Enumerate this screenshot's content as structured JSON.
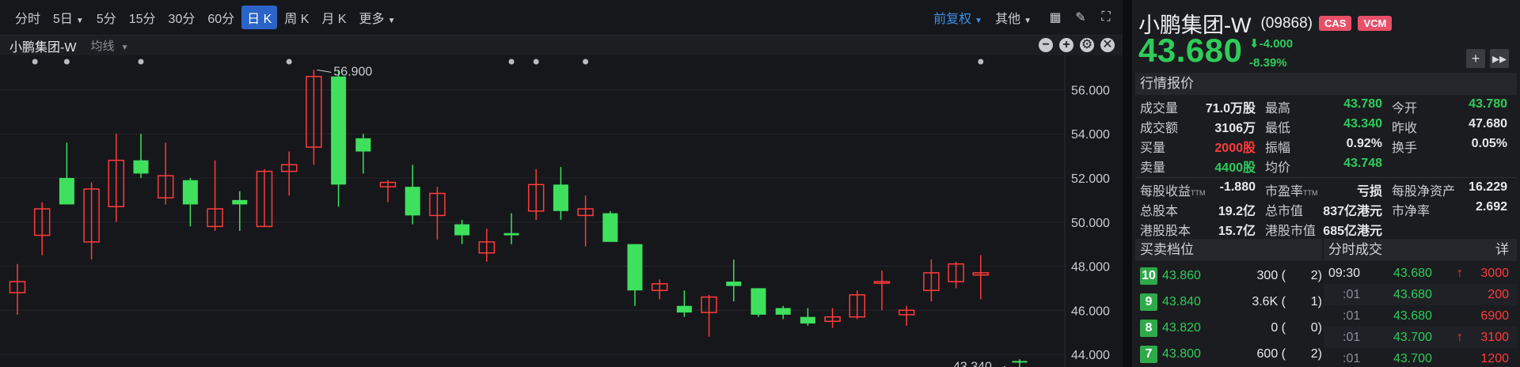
{
  "toolbar": {
    "periods": [
      {
        "label": "分时",
        "caret": false,
        "active": false
      },
      {
        "label": "5日",
        "caret": true,
        "active": false
      },
      {
        "label": "5分",
        "caret": false,
        "active": false
      },
      {
        "label": "15分",
        "caret": false,
        "active": false
      },
      {
        "label": "30分",
        "caret": false,
        "active": false
      },
      {
        "label": "60分",
        "caret": false,
        "active": false
      },
      {
        "label": "日 K",
        "caret": false,
        "active": true
      },
      {
        "label": "周 K",
        "caret": false,
        "active": false
      },
      {
        "label": "月 K",
        "caret": false,
        "active": false
      },
      {
        "label": "更多",
        "caret": true,
        "active": false
      }
    ],
    "adjust_label": "前复权",
    "other_label": "其他",
    "icons": [
      "layout-grid-icon",
      "pen-icon",
      "fullscreen-icon"
    ]
  },
  "chart_header": {
    "name": "小鹏集团-W",
    "indicator": "均线",
    "controls": [
      "−",
      "+",
      "⚙",
      "✕"
    ]
  },
  "chart_data": {
    "type": "candlestick",
    "ylim": [
      43.5,
      57.2
    ],
    "y_ticks": [
      "56.000",
      "54.000",
      "52.000",
      "50.000",
      "48.000",
      "46.000",
      "44.000"
    ],
    "y_tick_values": [
      56,
      54,
      52,
      50,
      48,
      46,
      44
    ],
    "annotations": {
      "high_label": "56.900",
      "low_label": "43.340"
    },
    "up_color": "#ff3b3b",
    "down_color": "#3ee05e",
    "candles": [
      {
        "o": 46.8,
        "h": 48.1,
        "l": 45.8,
        "c": 47.3
      },
      {
        "o": 49.4,
        "h": 50.9,
        "l": 48.5,
        "c": 50.6
      },
      {
        "o": 52.0,
        "h": 53.6,
        "l": 51.0,
        "c": 50.8
      },
      {
        "o": 49.1,
        "h": 51.8,
        "l": 48.3,
        "c": 51.5
      },
      {
        "o": 50.7,
        "h": 54.0,
        "l": 50.0,
        "c": 52.8
      },
      {
        "o": 52.8,
        "h": 54.0,
        "l": 52.0,
        "c": 52.2
      },
      {
        "o": 51.1,
        "h": 53.6,
        "l": 50.8,
        "c": 52.1
      },
      {
        "o": 51.9,
        "h": 52.0,
        "l": 49.8,
        "c": 50.8
      },
      {
        "o": 49.8,
        "h": 52.8,
        "l": 49.6,
        "c": 50.6
      },
      {
        "o": 51.0,
        "h": 51.4,
        "l": 49.6,
        "c": 50.8
      },
      {
        "o": 49.8,
        "h": 52.4,
        "l": 49.8,
        "c": 52.3
      },
      {
        "o": 52.3,
        "h": 53.2,
        "l": 51.2,
        "c": 52.6
      },
      {
        "o": 53.4,
        "h": 56.9,
        "l": 52.6,
        "c": 56.6
      },
      {
        "o": 56.6,
        "h": 56.9,
        "l": 50.7,
        "c": 51.7
      },
      {
        "o": 53.8,
        "h": 54.0,
        "l": 52.2,
        "c": 53.2
      },
      {
        "o": 51.6,
        "h": 51.9,
        "l": 50.9,
        "c": 51.8
      },
      {
        "o": 51.6,
        "h": 52.6,
        "l": 49.9,
        "c": 50.3
      },
      {
        "o": 50.3,
        "h": 51.6,
        "l": 49.2,
        "c": 51.3
      },
      {
        "o": 49.9,
        "h": 50.1,
        "l": 49.0,
        "c": 49.4
      },
      {
        "o": 48.6,
        "h": 49.7,
        "l": 48.2,
        "c": 49.1
      },
      {
        "o": 49.5,
        "h": 50.4,
        "l": 49.0,
        "c": 49.4
      },
      {
        "o": 50.5,
        "h": 52.4,
        "l": 50.1,
        "c": 51.7
      },
      {
        "o": 51.7,
        "h": 52.5,
        "l": 50.1,
        "c": 50.5
      },
      {
        "o": 50.3,
        "h": 51.2,
        "l": 48.9,
        "c": 50.6
      },
      {
        "o": 50.4,
        "h": 50.5,
        "l": 49.1,
        "c": 49.1
      },
      {
        "o": 49.0,
        "h": 49.0,
        "l": 46.2,
        "c": 46.9
      },
      {
        "o": 46.9,
        "h": 47.4,
        "l": 46.5,
        "c": 47.2
      },
      {
        "o": 46.2,
        "h": 46.9,
        "l": 45.7,
        "c": 45.9
      },
      {
        "o": 45.9,
        "h": 46.7,
        "l": 44.8,
        "c": 46.6
      },
      {
        "o": 47.3,
        "h": 48.3,
        "l": 46.4,
        "c": 47.1
      },
      {
        "o": 47.0,
        "h": 47.0,
        "l": 45.7,
        "c": 45.8
      },
      {
        "o": 46.1,
        "h": 46.2,
        "l": 45.6,
        "c": 45.8
      },
      {
        "o": 45.7,
        "h": 46.1,
        "l": 45.3,
        "c": 45.4
      },
      {
        "o": 45.5,
        "h": 46.1,
        "l": 45.2,
        "c": 45.7
      },
      {
        "o": 45.7,
        "h": 46.9,
        "l": 45.6,
        "c": 46.7
      },
      {
        "o": 47.3,
        "h": 47.8,
        "l": 46.0,
        "c": 47.3
      },
      {
        "o": 45.8,
        "h": 46.2,
        "l": 45.3,
        "c": 46.0
      },
      {
        "o": 46.9,
        "h": 48.3,
        "l": 46.4,
        "c": 47.7
      },
      {
        "o": 47.3,
        "h": 48.2,
        "l": 47.0,
        "c": 48.1
      },
      {
        "o": 47.6,
        "h": 48.5,
        "l": 46.5,
        "c": 47.7
      },
      {
        "o": 43.7,
        "h": 43.78,
        "l": 43.34,
        "c": 43.68
      }
    ]
  },
  "quote": {
    "name": "小鹏集团-W",
    "code": "(09868)",
    "tags": [
      "CAS",
      "VCM"
    ],
    "price": "43.680",
    "change": "-4.000",
    "change_pct": "-8.39%",
    "buttons": [
      "+",
      "▸▸"
    ],
    "section_title": "行情报价",
    "rows": [
      [
        {
          "l": "成交量",
          "v": "71.0万股",
          "c": "white"
        },
        {
          "l": "最高",
          "v": "43.780",
          "c": "green"
        },
        {
          "l": "今开",
          "v": "43.780",
          "c": "green"
        }
      ],
      [
        {
          "l": "成交额",
          "v": "3106万",
          "c": "white"
        },
        {
          "l": "最低",
          "v": "43.340",
          "c": "green"
        },
        {
          "l": "昨收",
          "v": "47.680",
          "c": "white"
        }
      ],
      [
        {
          "l": "买量",
          "v": "2000股",
          "c": "red"
        },
        {
          "l": "振幅",
          "v": "0.92%",
          "c": "white"
        },
        {
          "l": "换手",
          "v": "0.05%",
          "c": "white"
        }
      ],
      [
        {
          "l": "卖量",
          "v": "4400股",
          "c": "green"
        },
        {
          "l": "均价",
          "v": "43.748",
          "c": "green"
        },
        {
          "l": "",
          "v": "",
          "c": "white"
        }
      ]
    ],
    "rows2": [
      [
        {
          "l": "每股收益",
          "ttm": "TTM",
          "v": "-1.880",
          "c": "white"
        },
        {
          "l": "市盈率",
          "ttm": "TTM",
          "v": "亏损",
          "c": "white"
        },
        {
          "l": "每股净资产",
          "ttm": "",
          "v": "16.229",
          "c": "white"
        }
      ],
      [
        {
          "l": "总股本",
          "ttm": "",
          "v": "19.2亿",
          "c": "white"
        },
        {
          "l": "总市值",
          "ttm": "",
          "v": "837亿港元",
          "c": "white"
        },
        {
          "l": "市净率",
          "ttm": "",
          "v": "2.692",
          "c": "white"
        }
      ],
      [
        {
          "l": "港股股本",
          "ttm": "",
          "v": "15.7亿",
          "c": "white"
        },
        {
          "l": "港股市值",
          "ttm": "",
          "v": "685亿港元",
          "c": "white"
        },
        {
          "l": "",
          "ttm": "",
          "v": "",
          "c": "white"
        }
      ]
    ],
    "book_title": "买卖档位",
    "book": [
      {
        "level": "10",
        "price": "43.860",
        "vol": "300 (",
        "cnt": "2)"
      },
      {
        "level": "9",
        "price": "43.840",
        "vol": "3.6K (",
        "cnt": "1)"
      },
      {
        "level": "8",
        "price": "43.820",
        "vol": "0 (",
        "cnt": "0)"
      },
      {
        "level": "7",
        "price": "43.800",
        "vol": "600 (",
        "cnt": "2)"
      }
    ],
    "ticks_title": "分时成交",
    "ticks_detail": "详",
    "ticks": [
      {
        "time": "09:30",
        "price": "43.680",
        "arrow": "↑",
        "vol": "3000",
        "sub": false
      },
      {
        "time": ":01",
        "price": "43.680",
        "arrow": "",
        "vol": "200",
        "sub": true
      },
      {
        "time": ":01",
        "price": "43.680",
        "arrow": "",
        "vol": "6900",
        "sub": true
      },
      {
        "time": ":01",
        "price": "43.700",
        "arrow": "↑",
        "vol": "3100",
        "sub": true
      },
      {
        "time": ":01",
        "price": "43.700",
        "arrow": "",
        "vol": "1200",
        "sub": true
      }
    ]
  }
}
